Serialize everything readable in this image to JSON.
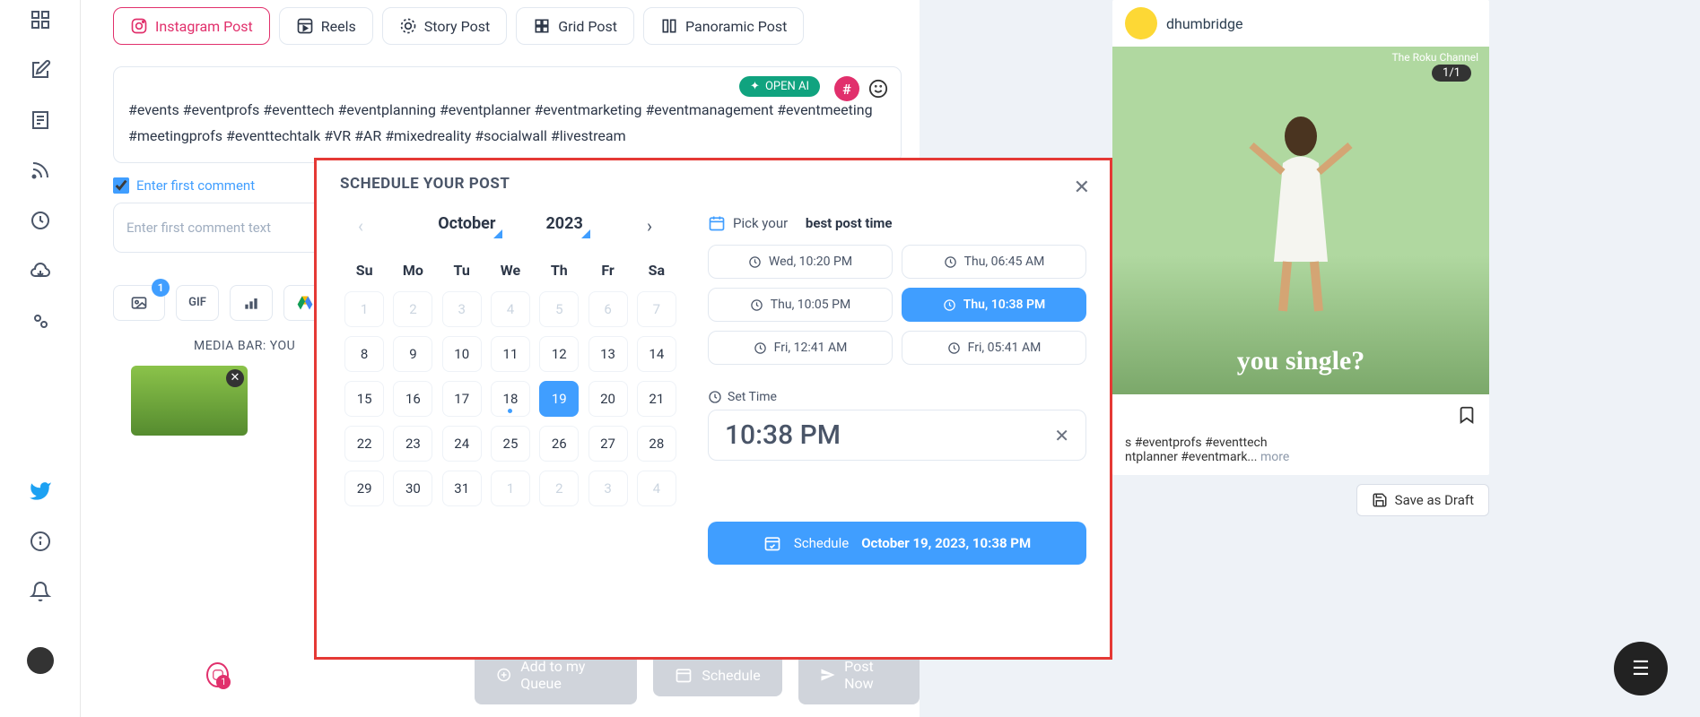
{
  "sidebar": {},
  "tabs": [
    {
      "label": "Instagram Post",
      "active": true
    },
    {
      "label": "Reels"
    },
    {
      "label": "Story Post"
    },
    {
      "label": "Grid Post"
    },
    {
      "label": "Panoramic Post"
    }
  ],
  "openai_label": "OPEN AI",
  "post_text": "#events #eventprofs #eventtech #eventplanning #eventplanner #eventmarketing #eventmanagement #eventmeeting #meetingprofs #eventtechtalk #VR #AR #mixedreality #socialwall #livestream",
  "first_comment_label": "Enter first comment",
  "comment_placeholder": "Enter first comment text",
  "media_bar_label": "MEDIA BAR: YOU",
  "media_count": "1",
  "gif_label": "GIF",
  "bottom_btns": {
    "queue": "Add to my Queue",
    "schedule": "Schedule",
    "post": "Post Now"
  },
  "account_count": "1",
  "preview": {
    "username": "dhumbridge",
    "counter": "1/1",
    "channel": "The Roku Channel",
    "overlay": "you single?",
    "caption_line1": "s #eventprofs #eventtech",
    "caption_line2": "ntplanner #eventmark... ",
    "more": "more",
    "save_draft": "Save as Draft"
  },
  "modal": {
    "title": "SCHEDULE YOUR POST",
    "month": "October",
    "year": "2023",
    "dow": [
      "Su",
      "Mo",
      "Tu",
      "We",
      "Th",
      "Fr",
      "Sa"
    ],
    "prev_days": [
      1,
      2,
      3,
      4,
      5,
      6,
      7
    ],
    "days": [
      8,
      9,
      10,
      11,
      12,
      13,
      14,
      15,
      16,
      17,
      18,
      19,
      20,
      21,
      22,
      23,
      24,
      25,
      26,
      27,
      28,
      29,
      30,
      31
    ],
    "next_days": [
      1,
      2,
      3,
      4
    ],
    "today": 18,
    "selected": 19,
    "pick_prefix": "Pick your",
    "pick_bold": "best post time",
    "times": [
      {
        "t": "Wed, 10:20 PM"
      },
      {
        "t": "Thu, 06:45 AM"
      },
      {
        "t": "Thu, 10:05 PM"
      },
      {
        "t": "Thu, 10:38 PM",
        "active": true
      },
      {
        "t": "Fri, 12:41 AM"
      },
      {
        "t": "Fri, 05:41 AM"
      }
    ],
    "set_time_label": "Set Time",
    "time_value": "10:38 PM",
    "schedule_word": "Schedule",
    "schedule_date": "October 19, 2023, 10:38 PM"
  }
}
